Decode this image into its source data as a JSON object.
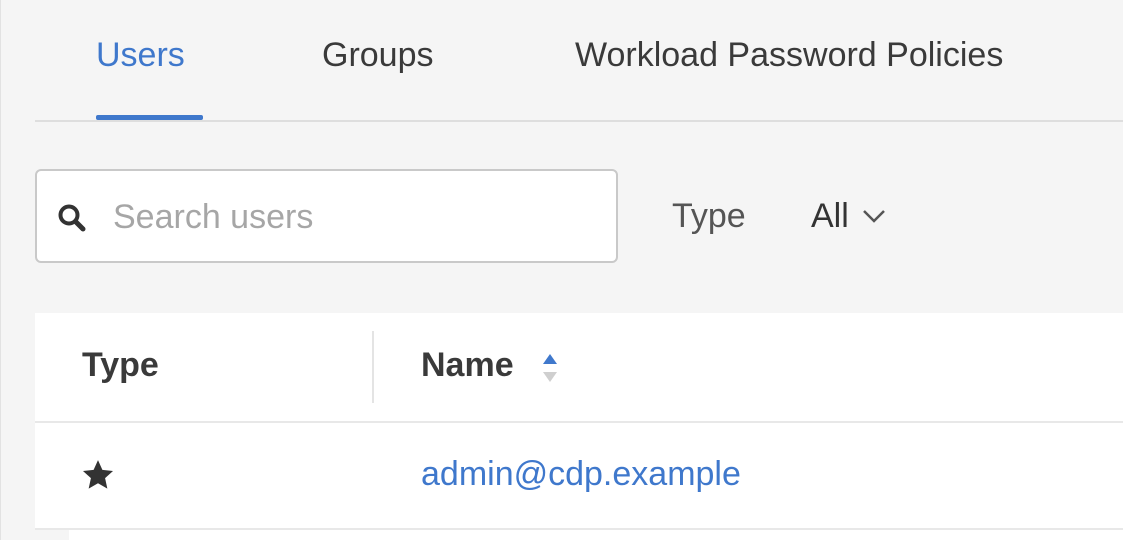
{
  "tabs": [
    {
      "label": "Users",
      "active": true
    },
    {
      "label": "Groups",
      "active": false
    },
    {
      "label": "Workload Password Policies",
      "active": false
    }
  ],
  "filters": {
    "search_placeholder": "Search users",
    "type_label": "Type",
    "type_value": "All"
  },
  "table": {
    "columns": [
      "Type",
      "Name"
    ],
    "sorted_column": "Name",
    "sort_direction": "ascending",
    "rows": [
      {
        "type_icon": "star-icon",
        "name": "admin@cdp.example"
      }
    ]
  },
  "colors": {
    "accent": "#3f78cc",
    "text": "#3a3a3a",
    "placeholder": "#a6a6a6",
    "background": "#f5f5f5"
  }
}
